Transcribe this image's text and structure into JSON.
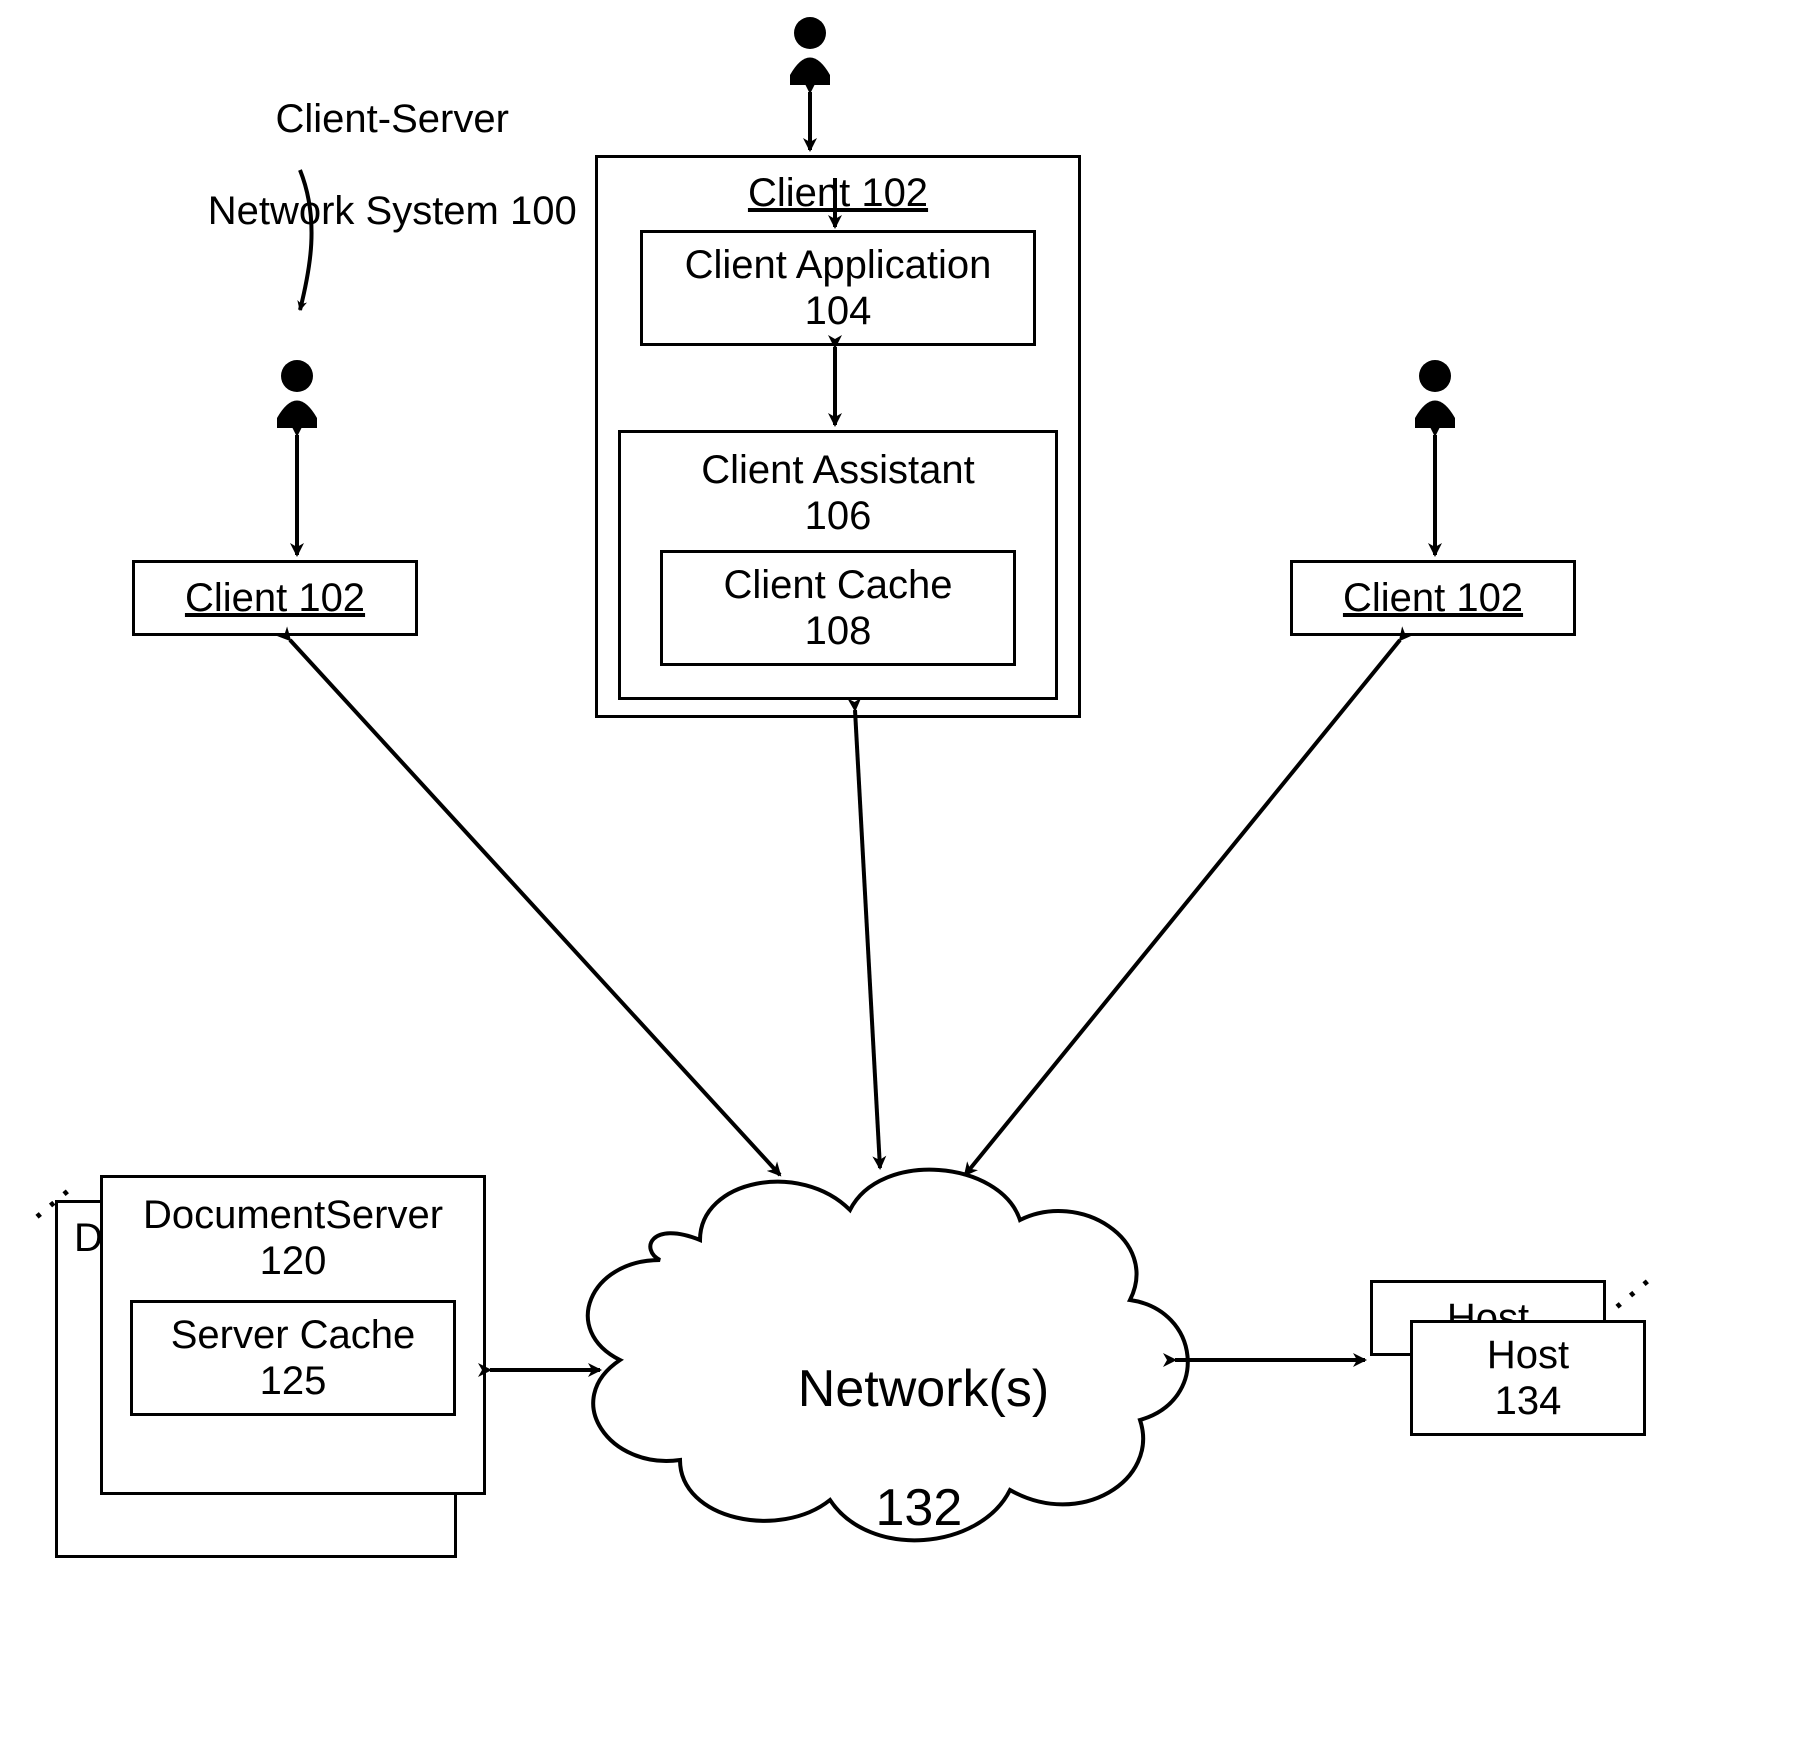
{
  "title_line1": "Client-Server",
  "title_line2": "Network System 100",
  "client_left": "Client 102",
  "client_mid_title": "Client 102",
  "client_app_line1": "Client Application",
  "client_app_line2": "104",
  "client_assistant_line1": "Client Assistant",
  "client_assistant_line2": "106",
  "client_cache_line1": "Client Cache",
  "client_cache_line2": "108",
  "client_right": "Client 102",
  "doc_server_back": "D",
  "doc_server_line1": "DocumentServer",
  "doc_server_line2": "120",
  "server_cache_line1": "Server Cache",
  "server_cache_line2": "125",
  "network_line1": "Network(s)",
  "network_line2": "132",
  "host_back": "Host",
  "host_front_line1": "Host",
  "host_front_line2": "134",
  "ellipsis": ". . ."
}
